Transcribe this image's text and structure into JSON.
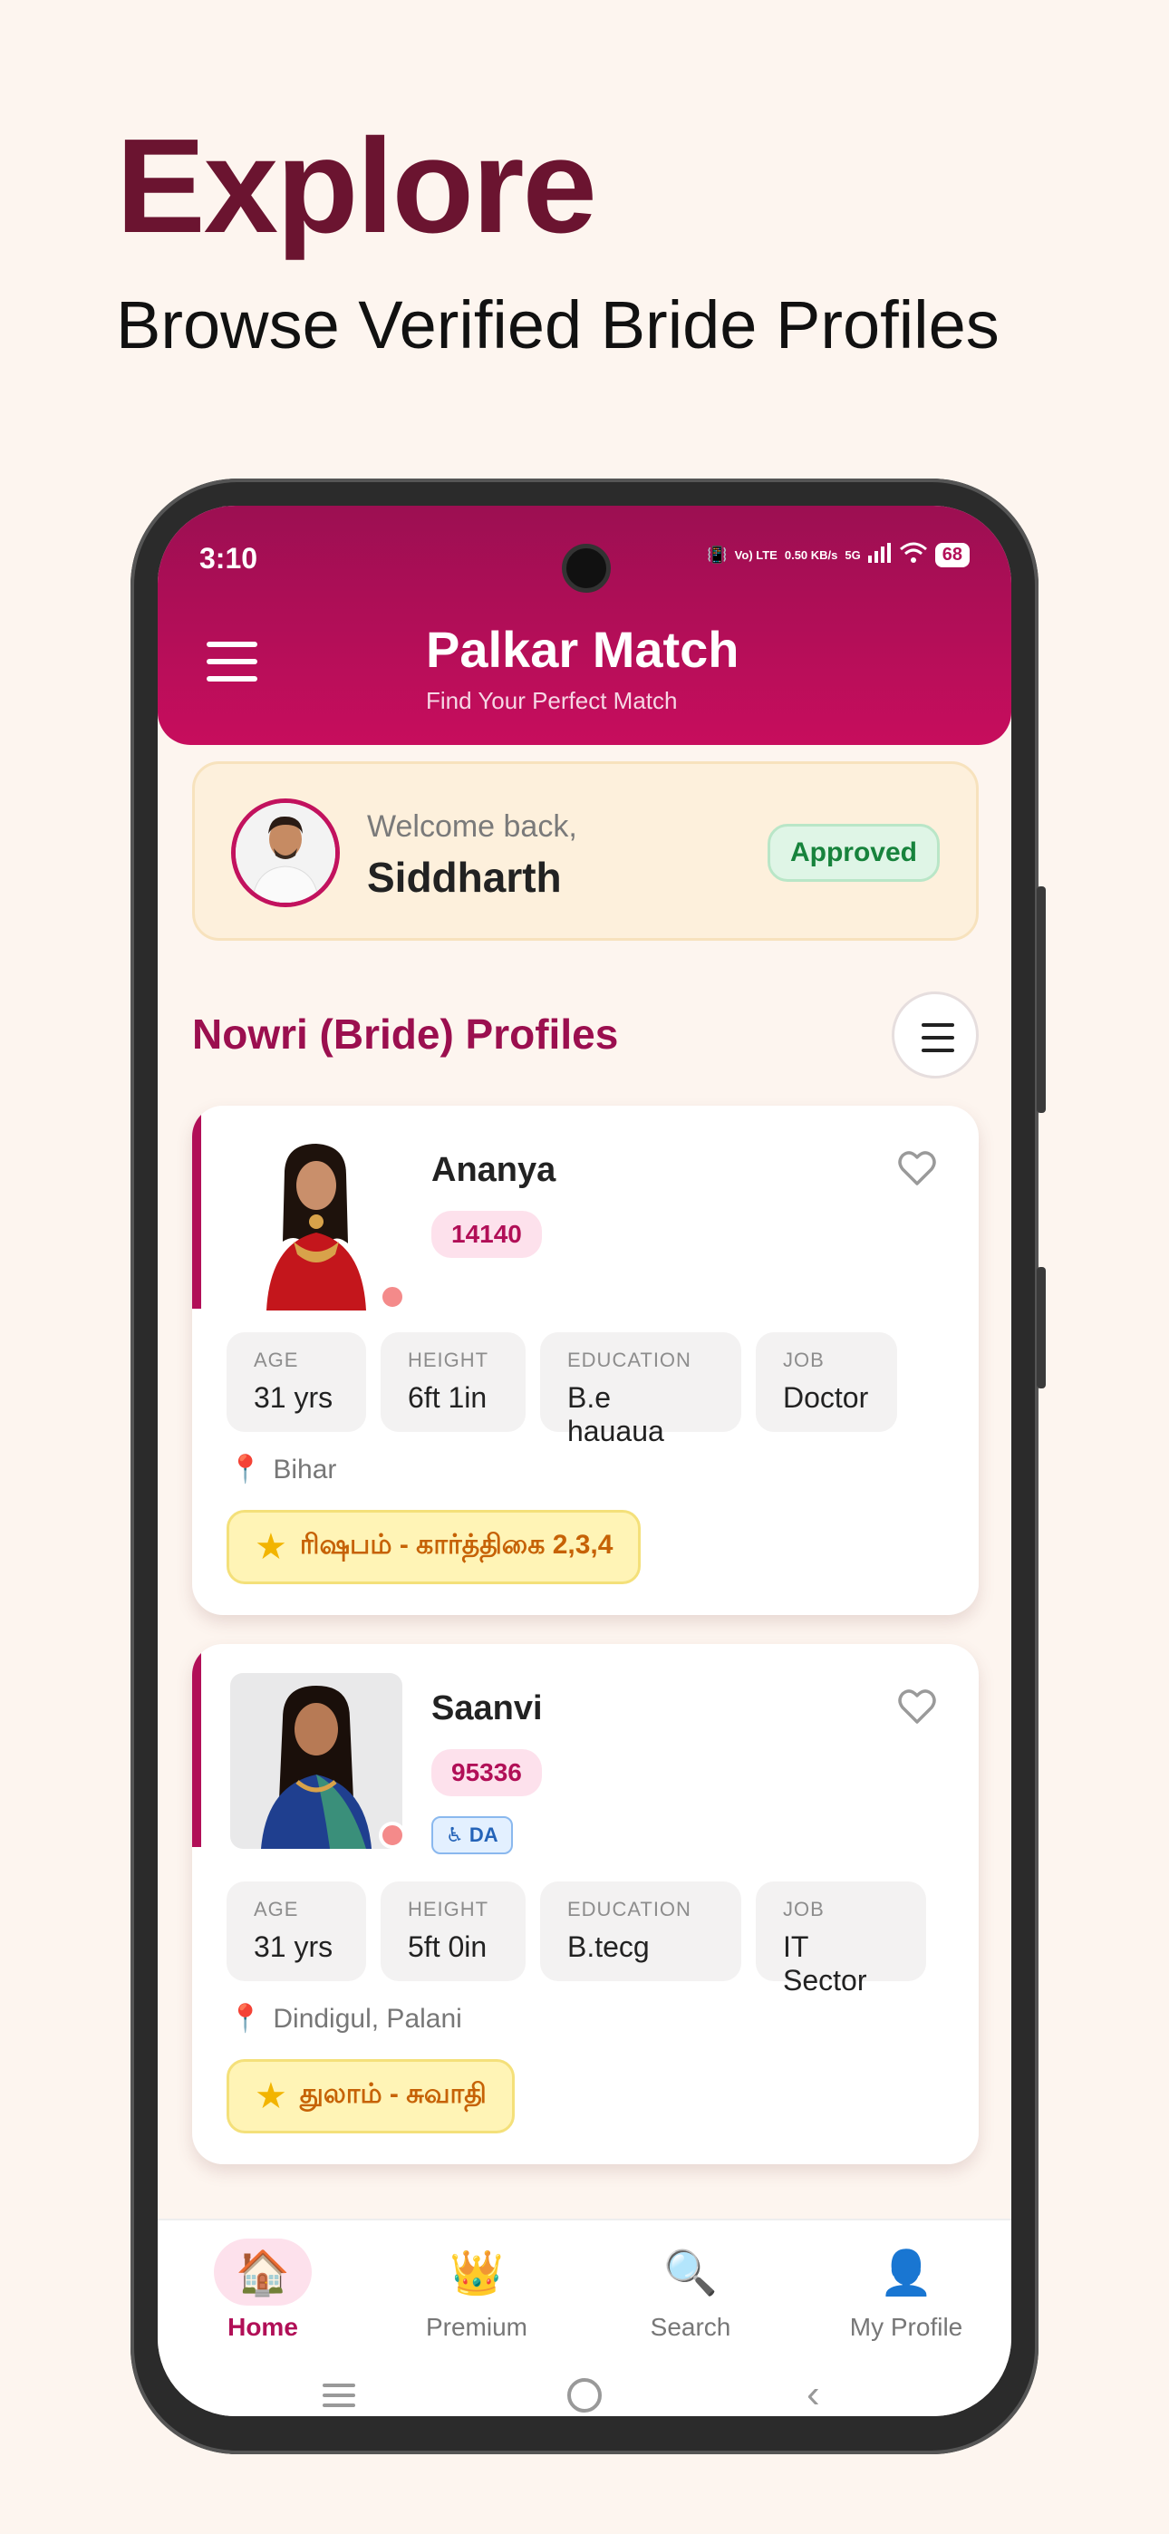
{
  "promo": {
    "headline": "Explore",
    "subline": "Browse Verified Bride Profiles"
  },
  "status_bar": {
    "time": "3:10",
    "network_1": "Vo) LTE",
    "speed": "0.50 KB/s",
    "network_2": "5G",
    "battery": "68"
  },
  "app_bar": {
    "title": "Palkar Match",
    "subtitle": "Find Your Perfect Match"
  },
  "welcome": {
    "label": "Welcome back,",
    "name": "Siddharth",
    "status": "Approved"
  },
  "section": {
    "title": "Nowri (Bride) Profiles"
  },
  "profiles": [
    {
      "name": "Ananya",
      "id": "14140",
      "stats": [
        {
          "label": "AGE",
          "value": "31 yrs"
        },
        {
          "label": "HEIGHT",
          "value": "6ft 1in"
        },
        {
          "label": "EDUCATION",
          "value": "B.e hauaua"
        },
        {
          "label": "JOB",
          "value": "Doctor"
        }
      ],
      "location": "Bihar",
      "star": "ரிஷபம் - கார்த்திகை 2,3,4"
    },
    {
      "name": "Saanvi",
      "id": "95336",
      "badge": "DA",
      "stats": [
        {
          "label": "AGE",
          "value": "31 yrs"
        },
        {
          "label": "HEIGHT",
          "value": "5ft 0in"
        },
        {
          "label": "EDUCATION",
          "value": "B.tecg"
        },
        {
          "label": "JOB",
          "value": "IT Sector"
        }
      ],
      "location": "Dindigul, Palani",
      "star": "துலாம் - சுவாதி"
    }
  ],
  "bottom_nav": {
    "items": [
      {
        "label": "Home",
        "icon": "home-icon"
      },
      {
        "label": "Premium",
        "icon": "crown-icon"
      },
      {
        "label": "Search",
        "icon": "search-icon"
      },
      {
        "label": "My Profile",
        "icon": "user-icon"
      }
    ]
  },
  "colors": {
    "brand": "#b10f57",
    "headline": "#6b1430",
    "approved": "#17833c",
    "star_text": "#c66206"
  }
}
